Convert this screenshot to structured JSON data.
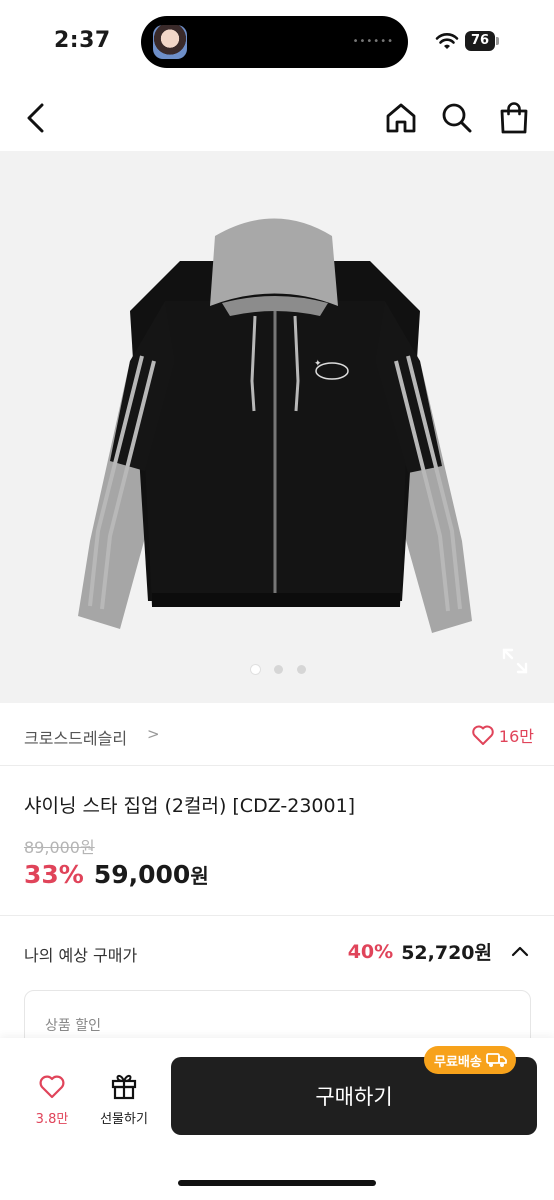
{
  "status_bar": {
    "time": "2:37",
    "battery": "76"
  },
  "nav": {
    "back_icon": "chevron-left-icon",
    "home_icon": "home-icon",
    "search_icon": "search-icon",
    "bag_icon": "shopping-bag-icon"
  },
  "product": {
    "brand": "크로스드레슬리",
    "brand_chevron": ">",
    "likes": "16만",
    "title": "샤이닝 스타 집업 (2컬러) [CDZ-23001]",
    "original_price": "89,000원",
    "discount_rate": "33%",
    "sale_price": "59,000",
    "sale_price_unit": "원",
    "carousel": {
      "total": 3,
      "active": 1
    }
  },
  "expected": {
    "label": "나의 예상 구매가",
    "rate": "40%",
    "price": "52,720원",
    "discount_box_title": "상품 할인"
  },
  "bottom_bar": {
    "like_count": "3.8만",
    "gift_label": "선물하기",
    "buy_label": "구매하기",
    "free_shipping": "무료배송"
  },
  "colors": {
    "accent": "#e0445a",
    "badge": "#f7a21b",
    "buy_button": "#1f1f1f"
  }
}
